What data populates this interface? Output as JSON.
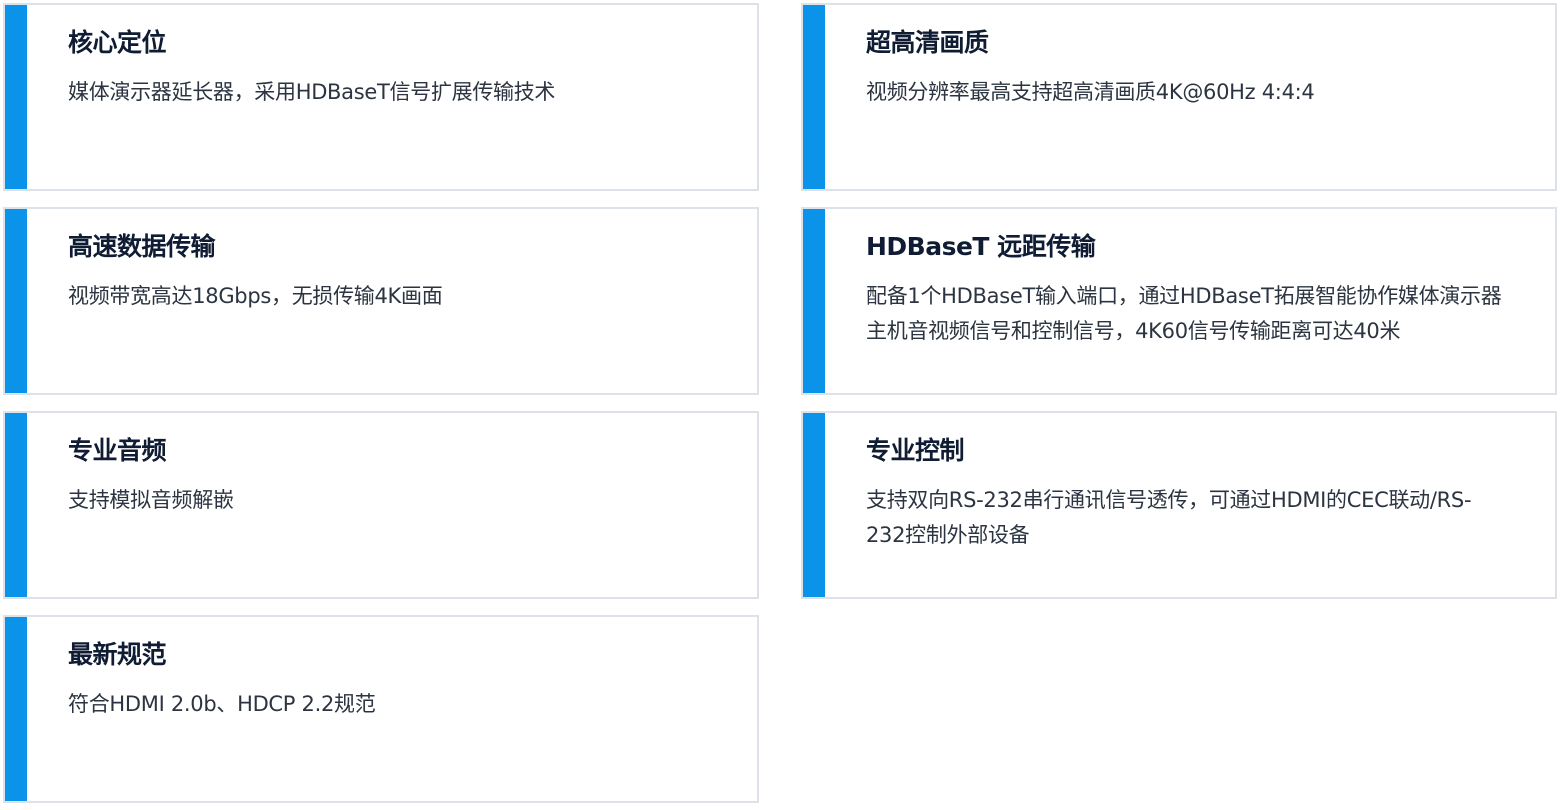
{
  "cards": [
    {
      "title": "核心定位",
      "desc": "媒体演示器延长器，采用HDBaseT信号扩展传输技术"
    },
    {
      "title": "超高清画质",
      "desc": "视频分辨率最高支持超高清画质4K@60Hz 4:4:4"
    },
    {
      "title": "高速数据传输",
      "desc": "视频带宽高达18Gbps，无损传输4K画面"
    },
    {
      "title": "HDBaseT 远距传输",
      "desc": "配备1个HDBaseT输入端口，通过HDBaseT拓展智能协作媒体演示器主机音视频信号和控制信号，4K60信号传输距离可达40米"
    },
    {
      "title": "专业音频",
      "desc": "支持模拟音频解嵌"
    },
    {
      "title": "专业控制",
      "desc": "支持双向RS-232串行通讯信号透传，可通过HDMI的CEC联动/RS-232控制外部设备"
    },
    {
      "title": "最新规范",
      "desc": "符合HDMI 2.0b、HDCP 2.2规范"
    }
  ],
  "colors": {
    "accent": "#0a93e8",
    "border": "#dde2e8",
    "title": "#0f1c33",
    "text": "#2b3440"
  }
}
